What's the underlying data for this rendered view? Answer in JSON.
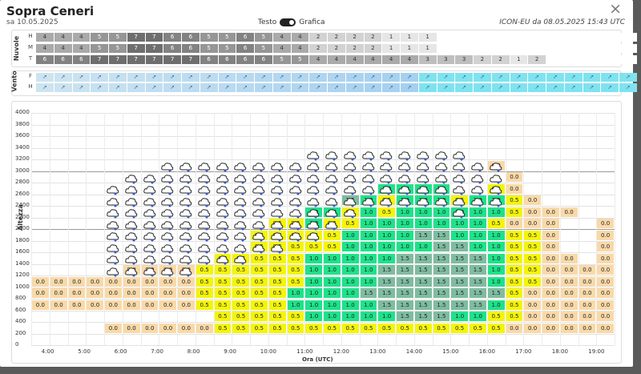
{
  "header": {
    "title": "Sopra Ceneri",
    "date": "sa 10.05.2025",
    "toggle_left": "Testo",
    "toggle_right": "Grafica",
    "model": "ICON-EU da 08.05.2025 15:43 UTC",
    "close": "×"
  },
  "clouds": {
    "label": "Nuvole",
    "rows": [
      "H",
      "M",
      "T"
    ],
    "H": [
      4,
      4,
      4,
      5,
      5,
      7,
      7,
      6,
      6,
      5,
      5,
      6,
      5,
      4,
      4,
      2,
      2,
      2,
      2,
      1,
      1,
      1,
      "",
      "",
      "",
      "",
      "",
      "",
      "",
      "",
      "",
      "",
      ""
    ],
    "M": [
      4,
      4,
      4,
      5,
      5,
      7,
      7,
      6,
      6,
      5,
      5,
      6,
      5,
      4,
      4,
      2,
      2,
      2,
      2,
      1,
      1,
      1,
      "",
      "",
      "",
      "",
      "",
      "",
      "",
      "",
      "",
      "",
      ""
    ],
    "T": [
      6,
      6,
      6,
      7,
      7,
      7,
      7,
      7,
      7,
      6,
      6,
      6,
      6,
      5,
      5,
      4,
      4,
      4,
      4,
      4,
      4,
      3,
      3,
      3,
      2,
      2,
      1,
      2,
      "",
      "",
      "",
      "",
      ""
    ]
  },
  "wind": {
    "label": "Vento",
    "rows": [
      "F",
      "H"
    ]
  },
  "grid": {
    "ylabel": "Altezza",
    "xlabel": "Ora (UTC)",
    "yticks": [
      "4000",
      "3800",
      "3600",
      "3400",
      "3200",
      "3000",
      "2800",
      "2600",
      "2400",
      "2200",
      "2000",
      "1800",
      "1600",
      "1400",
      "1200",
      "1000",
      "800",
      "600",
      "400",
      "200",
      "0"
    ],
    "xticks": [
      "4:00",
      "5:00",
      "6:00",
      "7:00",
      "8:00",
      "9:00",
      "10:00",
      "11:00",
      "12:00",
      "13:00",
      "14:00",
      "15:00",
      "16:00",
      "17:00",
      "18:00",
      "19:00"
    ],
    "colors": {
      "0.0": "#f9d9a8",
      "0.5": "#f4f40c",
      "1.0": "#1ee28a",
      "1.5": "#7fbca0",
      "snow": "#ffffff"
    }
  },
  "cells_rows": [
    {
      "y": 200,
      "vals": {
        "4": "0.0",
        "5": "0.0",
        "6": "0.0",
        "7": "0.0",
        "8": "0.0",
        "9": "0.0",
        "10": "0.5",
        "11": "0.5",
        "12": "0.5",
        "13": "0.5",
        "14": "0.5",
        "15": "0.5",
        "16": "0.5",
        "17": "0.5",
        "18": "0.5",
        "19": "0.5",
        "20": "0.5",
        "21": "0.5",
        "22": "0.5",
        "23": "0.5",
        "24": "0.5",
        "25": "0.5",
        "26": "0.0",
        "27": "0.0",
        "28": "0.0",
        "29": "0.0",
        "30": "0.0",
        "31": "0.0"
      }
    },
    {
      "y": 400,
      "vals": {
        "10": "0.5",
        "11": "0.5",
        "12": "0.5",
        "13": "0.5",
        "14": "0.5",
        "15": "1.0",
        "16": "1.0",
        "17": "1.0",
        "18": "1.0",
        "19": "1.0",
        "20": "1.5",
        "21": "1.5",
        "22": "1.5",
        "23": "1.0",
        "24": "1.0",
        "25": "0.5",
        "26": "0.5",
        "27": "0.0",
        "28": "0.0",
        "29": "0.0",
        "30": "0.0",
        "31": "0.0"
      }
    },
    {
      "y": 600,
      "vals": {
        "0": "0.0",
        "1": "0.0",
        "2": "0.0",
        "3": "0.0",
        "4": "0.0",
        "5": "0.0",
        "6": "0.0",
        "7": "0.0",
        "8": "0.0",
        "9": "0.5",
        "10": "0.5",
        "11": "0.5",
        "12": "0.5",
        "13": "0.5",
        "14": "1.0",
        "15": "1.0",
        "16": "1.0",
        "17": "1.0",
        "18": "1.0",
        "19": "1.5",
        "20": "1.5",
        "21": "1.5",
        "22": "1.5",
        "23": "1.5",
        "24": "1.5",
        "25": "1.0",
        "26": "0.5",
        "27": "0.0",
        "28": "0.0",
        "29": "0.0",
        "30": "0.0",
        "31": "0.0"
      }
    },
    {
      "y": 800,
      "vals": {
        "0": "0.0",
        "1": "0.0",
        "2": "0.0",
        "3": "0.0",
        "4": "0.0",
        "5": "0.0",
        "6": "0.0",
        "7": "0.0",
        "8": "0.0",
        "9": "0.5",
        "10": "0.5",
        "11": "0.5",
        "12": "0.5",
        "13": "0.5",
        "14": "1.0",
        "15": "1.0",
        "16": "1.0",
        "17": "1.0",
        "18": "1.5",
        "19": "1.5",
        "20": "1.5",
        "21": "1.5",
        "22": "1.5",
        "23": "1.5",
        "24": "1.5",
        "25": "1.5",
        "26": "0.5",
        "27": "0.0",
        "28": "0.0",
        "29": "0.0",
        "30": "0.0",
        "31": "0.0"
      }
    },
    {
      "y": 1000,
      "vals": {
        "0": "0.0",
        "1": "0.0",
        "2": "0.0",
        "3": "0.0",
        "4": "0.0",
        "5": "0.0",
        "6": "0.0",
        "7": "0.0",
        "8": "0.0",
        "9": "0.5",
        "10": "0.5",
        "11": "0.5",
        "12": "0.5",
        "13": "0.5",
        "14": "0.5",
        "15": "1.0",
        "16": "1.0",
        "17": "1.0",
        "18": "1.0",
        "19": "1.5",
        "20": "1.5",
        "21": "1.5",
        "22": "1.5",
        "23": "1.5",
        "24": "1.5",
        "25": "1.0",
        "26": "0.5",
        "27": "0.5",
        "28": "0.0",
        "29": "0.0",
        "30": "0.0",
        "31": "0.0"
      }
    },
    {
      "y": 1200,
      "vals": {
        "5": "0.0",
        "6": "0.0",
        "7": "0.0",
        "8": "0.0",
        "9": "0.5",
        "10": "0.5",
        "11": "0.5",
        "12": "0.5",
        "13": "0.5",
        "14": "0.5",
        "15": "1.0",
        "16": "1.0",
        "17": "1.0",
        "18": "1.0",
        "19": "1.5",
        "20": "1.5",
        "21": "1.5",
        "22": "1.5",
        "23": "1.5",
        "24": "1.5",
        "25": "1.0",
        "26": "0.5",
        "27": "0.5",
        "28": "0.0",
        "29": "0.0",
        "30": "0.0",
        "31": "0.0"
      }
    },
    {
      "y": 1400,
      "vals": {
        "10": "0.5",
        "11": "0.5",
        "12": "0.5",
        "13": "0.5",
        "14": "0.5",
        "15": "1.0",
        "16": "1.0",
        "17": "1.0",
        "18": "1.0",
        "19": "1.0",
        "20": "1.5",
        "21": "1.5",
        "22": "1.5",
        "23": "1.5",
        "24": "1.5",
        "25": "1.0",
        "26": "0.5",
        "27": "0.5",
        "28": "0.0",
        "29": "0.0",
        "31": "0.0"
      }
    },
    {
      "y": 1600,
      "vals": {
        "12": "0.5",
        "13": "0.5",
        "14": "0.5",
        "15": "0.5",
        "16": "0.5",
        "17": "1.0",
        "18": "1.0",
        "19": "1.0",
        "20": "1.0",
        "21": "1.0",
        "22": "1.5",
        "23": "1.5",
        "24": "1.0",
        "25": "1.0",
        "26": "0.5",
        "27": "0.5",
        "28": "0.0",
        "31": "0.0"
      }
    },
    {
      "y": 1800,
      "vals": {
        "12": "0.5",
        "13": "0.5",
        "14": "0.5",
        "15": "0.5",
        "16": "0.5",
        "17": "1.0",
        "18": "1.0",
        "19": "1.0",
        "20": "1.0",
        "21": "1.5",
        "22": "1.5",
        "23": "1.0",
        "24": "1.0",
        "25": "1.0",
        "26": "0.5",
        "27": "0.5",
        "28": "0.0",
        "31": "0.0"
      }
    },
    {
      "y": 2000,
      "vals": {
        "13": "0.5",
        "14": "0.5",
        "15": "1.0",
        "16": "0.5",
        "17": "0.5",
        "18": "1.0",
        "19": "1.0",
        "20": "1.0",
        "21": "1.0",
        "22": "1.0",
        "23": "1.0",
        "24": "1.0",
        "25": "0.5",
        "26": "0.0",
        "27": "0.0",
        "28": "0.0",
        "31": "0.0"
      }
    },
    {
      "y": 2200,
      "vals": {
        "15": "1.0",
        "16": "1.0",
        "17": "0.5",
        "18": "1.0",
        "19": "0.5",
        "20": "1.0",
        "21": "1.0",
        "22": "1.0",
        "23": "1.0",
        "24": "1.0",
        "25": "1.0",
        "26": "0.5",
        "27": "0.0",
        "28": "0.0",
        "29": "0.0"
      }
    },
    {
      "y": 2400,
      "vals": {
        "17": "1.5",
        "18": "1.0",
        "19": "0.5",
        "20": "1.0",
        "21": "1.0",
        "22": "1.0",
        "23": "0.5",
        "24": "1.0",
        "25": "1.0",
        "26": "0.5",
        "27": "0.0"
      }
    },
    {
      "y": 2600,
      "vals": {
        "19": "1.0",
        "20": "1.0",
        "21": "1.0",
        "22": "1.0",
        "25": "0.5",
        "26": "0.0"
      }
    },
    {
      "y": 2800,
      "vals": {
        "26": "0.0"
      }
    },
    {
      "y": 3000,
      "vals": {
        "25": "0.0"
      }
    }
  ],
  "snow": [
    [
      4,
      2600,
      2800
    ],
    [
      4,
      1200,
      2600
    ],
    [
      5,
      1200,
      3000
    ],
    [
      6,
      1200,
      3000
    ],
    [
      7,
      1200,
      3200
    ],
    [
      8,
      1200,
      3200
    ],
    [
      9,
      1400,
      3200
    ],
    [
      10,
      1400,
      3200
    ],
    [
      11,
      1400,
      3200
    ],
    [
      12,
      1600,
      3200
    ],
    [
      13,
      1600,
      3200
    ],
    [
      14,
      1800,
      3200
    ],
    [
      15,
      1800,
      3400
    ],
    [
      16,
      2000,
      3400
    ],
    [
      17,
      2200,
      3400
    ],
    [
      18,
      2400,
      3400
    ],
    [
      19,
      2400,
      3400
    ],
    [
      20,
      2400,
      3400
    ],
    [
      21,
      2400,
      3400
    ],
    [
      22,
      2400,
      3400
    ],
    [
      23,
      2200,
      3400
    ],
    [
      24,
      2400,
      3200
    ],
    [
      25,
      2400,
      3200
    ]
  ]
}
